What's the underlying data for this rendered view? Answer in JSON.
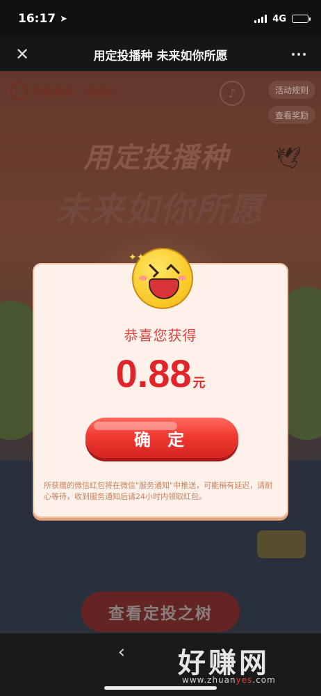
{
  "status_bar": {
    "time": "16:17",
    "network": "4G"
  },
  "nav": {
    "title": "用定投播种 未来如你所愿",
    "close_icon": "close-icon",
    "more_icon": "more-icon"
  },
  "background": {
    "brand": "华夏基金",
    "brand_sub": "定投记",
    "rules_button": "活动规则",
    "rewards_button": "查看奖励",
    "hero_line_1": "用定投播种",
    "hero_line_2": "未来如你所愿",
    "view_tree_button": "查看定投之树"
  },
  "modal": {
    "congrats": "恭喜您获得",
    "amount": "0.88",
    "unit": "元",
    "confirm_button": "确 定",
    "note": "所获赠的微信红包将在微信\"服务通知\"中推送，可能稍有延迟，请耐心等待，收到服务通知后请24小时内领取红包。"
  },
  "bottom_bar": {
    "back_icon": "chevron-left-icon",
    "watermark": "好赚网",
    "watermark_url_prefix": "www.zhuan",
    "watermark_url_highlight": "yes",
    "watermark_url_suffix": ".com"
  },
  "colors": {
    "primary_red": "#e0242a",
    "modal_bg": "#fdf1ea",
    "button_red": "#f03a32"
  }
}
